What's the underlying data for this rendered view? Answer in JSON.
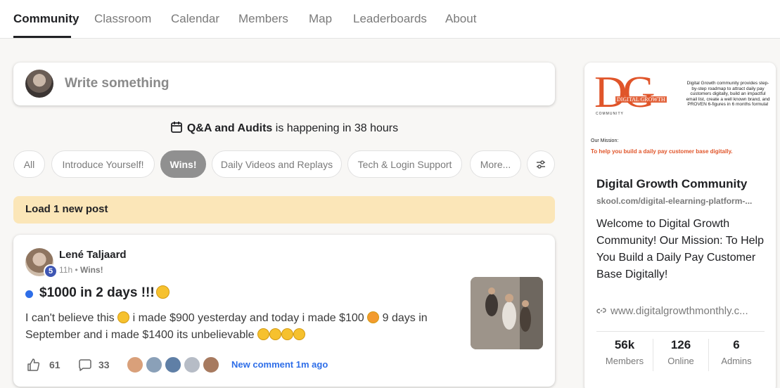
{
  "nav": {
    "tabs": [
      {
        "label": "Community",
        "active": true
      },
      {
        "label": "Classroom"
      },
      {
        "label": "Calendar"
      },
      {
        "label": "Members"
      },
      {
        "label": "Map"
      },
      {
        "label": "Leaderboards"
      },
      {
        "label": "About"
      }
    ]
  },
  "composer": {
    "placeholder": "Write something"
  },
  "event": {
    "name": "Q&A and Audits",
    "suffix": "is happening in 38 hours",
    "icon": "calendar-icon"
  },
  "filters": {
    "chips": [
      "All",
      "Introduce Yourself!",
      "Wins!",
      "Daily Videos and Replays",
      "Tech & Login Support",
      "More..."
    ],
    "active": "Wins!",
    "settings_icon": "sliders-icon"
  },
  "load_new": {
    "label": "Load 1 new post"
  },
  "post": {
    "author": "Lené Taljaard",
    "level": "5",
    "time": "11h",
    "separator": "•",
    "category": "Wins!",
    "title": "$1000 in 2 days !!!",
    "body_part1": "I can't believe this",
    "body_part2": "i made $900 yesterday and today i made $100",
    "body_part3": "9 days in September and i made $1400 its unbelievable",
    "likes": "61",
    "comments": "33",
    "new_comment": "New comment 1m ago",
    "accent_color": "#2e6ee8"
  },
  "sidebar": {
    "banner": {
      "logo": "DG",
      "logo_sub": "DIGITAL GROWTH",
      "logo_community": "COMMUNITY",
      "text": "Digital Growth community provides step-by-step roadmap to attract daily pay customers digitally, build an impactful email list, create a well known brand, and PROVEN 6-figures in 6 months formula!",
      "mission_label": "Our Mission:",
      "mission_text": "To help you build a daily pay customer base digitally."
    },
    "name": "Digital Growth Community",
    "url": "skool.com/digital-elearning-platform-...",
    "description": "Welcome to Digital Growth Community! Our Mission: To Help You Build a Daily Pay Customer Base Digitally!",
    "link": "www.digitalgrowthmonthly.c...",
    "stats": [
      {
        "value": "56k",
        "label": "Members"
      },
      {
        "value": "126",
        "label": "Online"
      },
      {
        "value": "6",
        "label": "Admins"
      }
    ],
    "brand_color": "#e0552a"
  }
}
